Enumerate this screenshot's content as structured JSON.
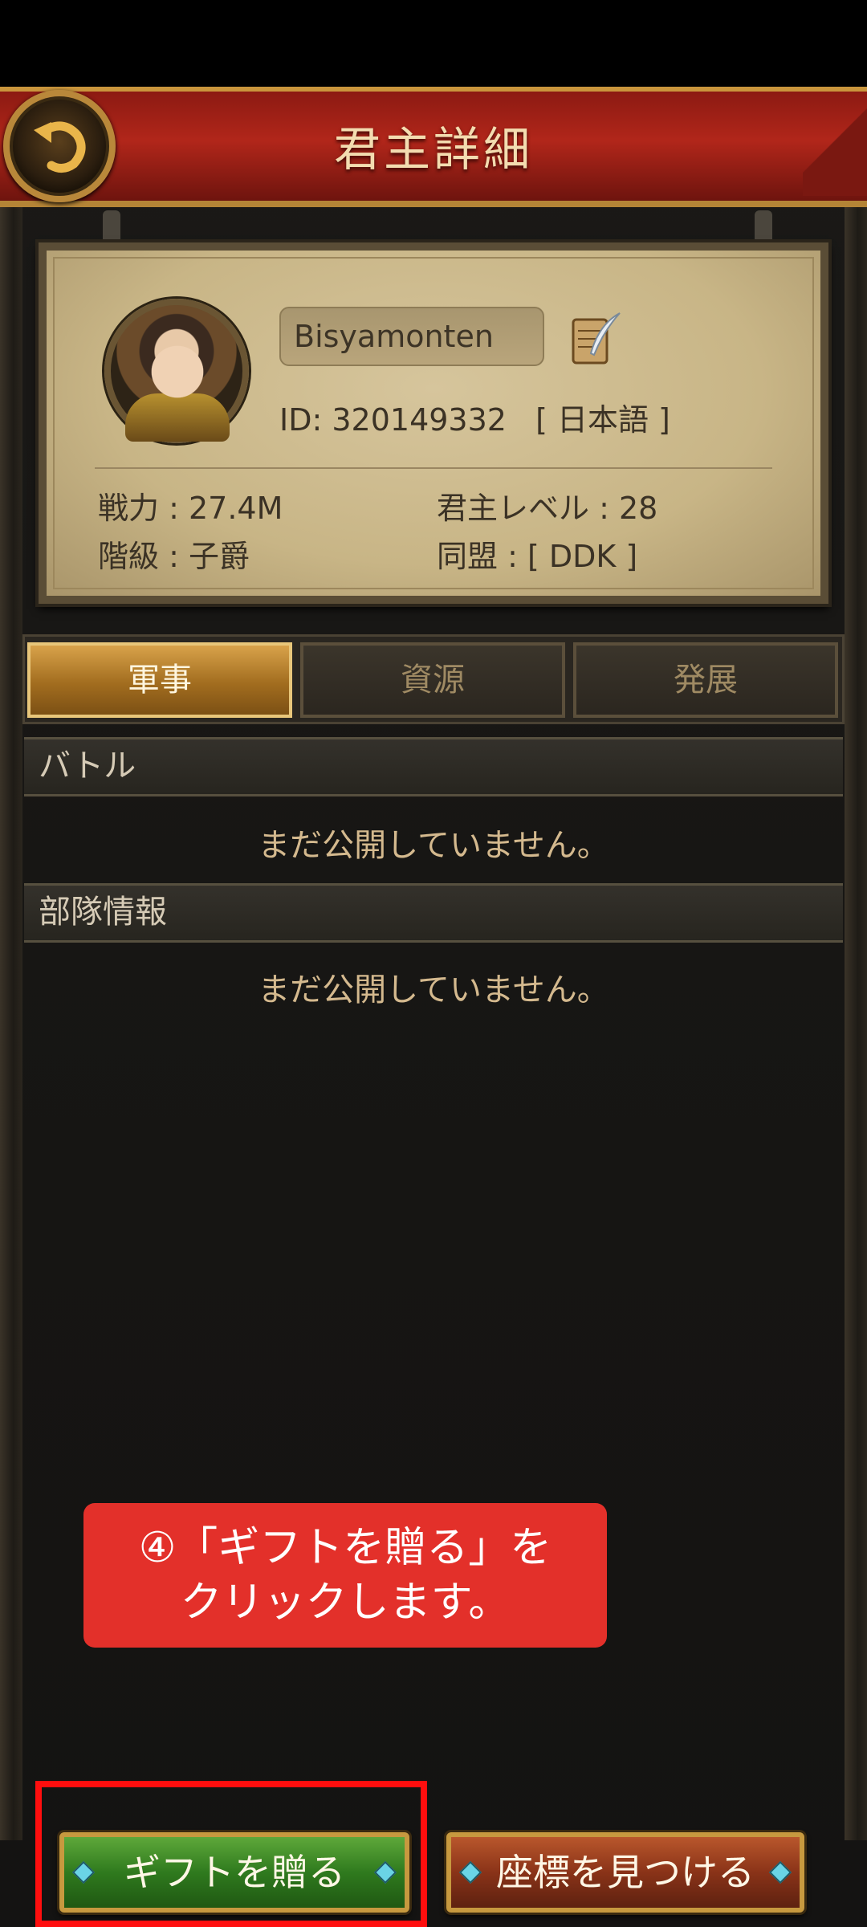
{
  "header": {
    "title": "君主詳細"
  },
  "profile": {
    "name": "Bisyamonten",
    "id_label": "ID:",
    "id_value": "320149332",
    "language": "[ 日本語 ]",
    "power": "戦力 : 27.4M",
    "lord_level": "君主レベル : 28",
    "rank": "階級 : 子爵",
    "alliance": "同盟 :  [ DDK ]"
  },
  "tabs": [
    {
      "label": "軍事",
      "active": true
    },
    {
      "label": "資源",
      "active": false
    },
    {
      "label": "発展",
      "active": false
    }
  ],
  "sections": [
    {
      "title": "バトル",
      "status": "まだ公開していません。"
    },
    {
      "title": "部隊情報",
      "status": "まだ公開していません。"
    }
  ],
  "callout": {
    "line1": "④「ギフトを贈る」を",
    "line2": "クリックします。"
  },
  "buttons": {
    "gift": "ギフトを贈る",
    "find_coordinates": "座標を見つける"
  },
  "colors": {
    "header_red": "#b1261a",
    "gold_border": "#c9953c",
    "active_tab": "#d8a24a",
    "gift_green": "#2f7a1e",
    "coord_red": "#8a3318",
    "callout_red": "#e3302a",
    "highlight_red": "#ff0e0e"
  },
  "icons": [
    "back-arrow-icon",
    "scroll-quill-icon",
    "gem-icon"
  ]
}
